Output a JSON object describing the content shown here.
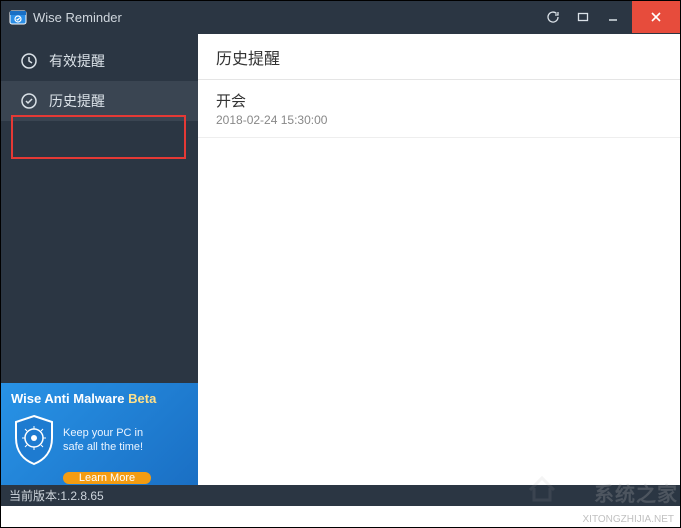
{
  "app": {
    "title": "Wise Reminder"
  },
  "sidebar": {
    "items": [
      {
        "label": "有效提醒"
      },
      {
        "label": "历史提醒"
      }
    ]
  },
  "main": {
    "header": "历史提醒",
    "reminders": [
      {
        "title": "开会",
        "time": "2018-02-24 15:30:00"
      }
    ]
  },
  "promo": {
    "title_main": "Wise Anti Malware ",
    "title_beta": "Beta",
    "line1": "Keep your PC in",
    "line2": "safe all the time!",
    "button": "Learn More"
  },
  "status": {
    "version_label": "当前版本:1.2.8.65"
  },
  "watermark": {
    "url": "XITONGZHIJIA.NET",
    "text": "系统之家"
  }
}
